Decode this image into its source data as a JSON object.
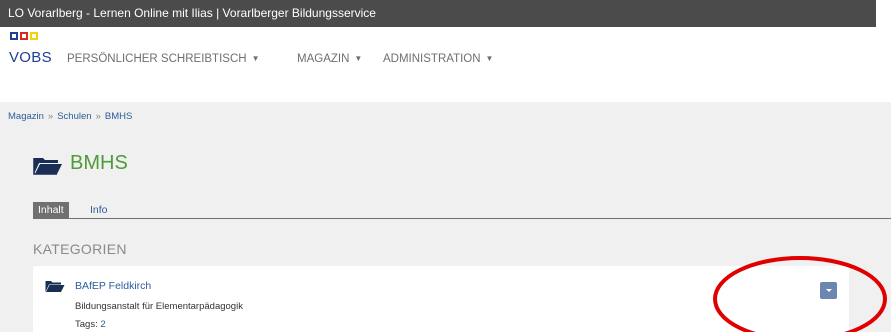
{
  "window": {
    "title": "LO Vorarlberg - Lernen Online mit Ilias | Vorarlberger Bildungsservice"
  },
  "logo": {
    "text": "VOBS",
    "colors": [
      "#1f3f94",
      "#d52b1e",
      "#f6d200"
    ]
  },
  "nav": {
    "items": [
      {
        "label": "PERSÖNLICHER SCHREIBTISCH",
        "has_caret": true
      },
      {
        "label": "MAGAZIN",
        "has_caret": true
      },
      {
        "label": "ADMINISTRATION",
        "has_caret": true
      }
    ],
    "caret": "▼"
  },
  "breadcrumb": {
    "items": [
      "Magazin",
      "Schulen",
      "BMHS"
    ],
    "separator": "»"
  },
  "page": {
    "title": "BMHS",
    "icon": "folder-icon"
  },
  "tabs": [
    {
      "label": "Inhalt",
      "active": true
    },
    {
      "label": "Info",
      "active": false
    }
  ],
  "section": {
    "title": "KATEGORIEN"
  },
  "category": {
    "title": "BAfEP Feldkirch",
    "description": "Bildungsanstalt für Elementarpädagogik",
    "tags_label": "Tags:",
    "tags_value": "2",
    "icon": "folder-icon",
    "action_icon": "chevron-down-icon"
  },
  "colors": {
    "topbar": "#4b4b4b",
    "accent_blue": "#2c5d9a",
    "title_green": "#4f9a3a",
    "annotation_red": "#e00000"
  }
}
